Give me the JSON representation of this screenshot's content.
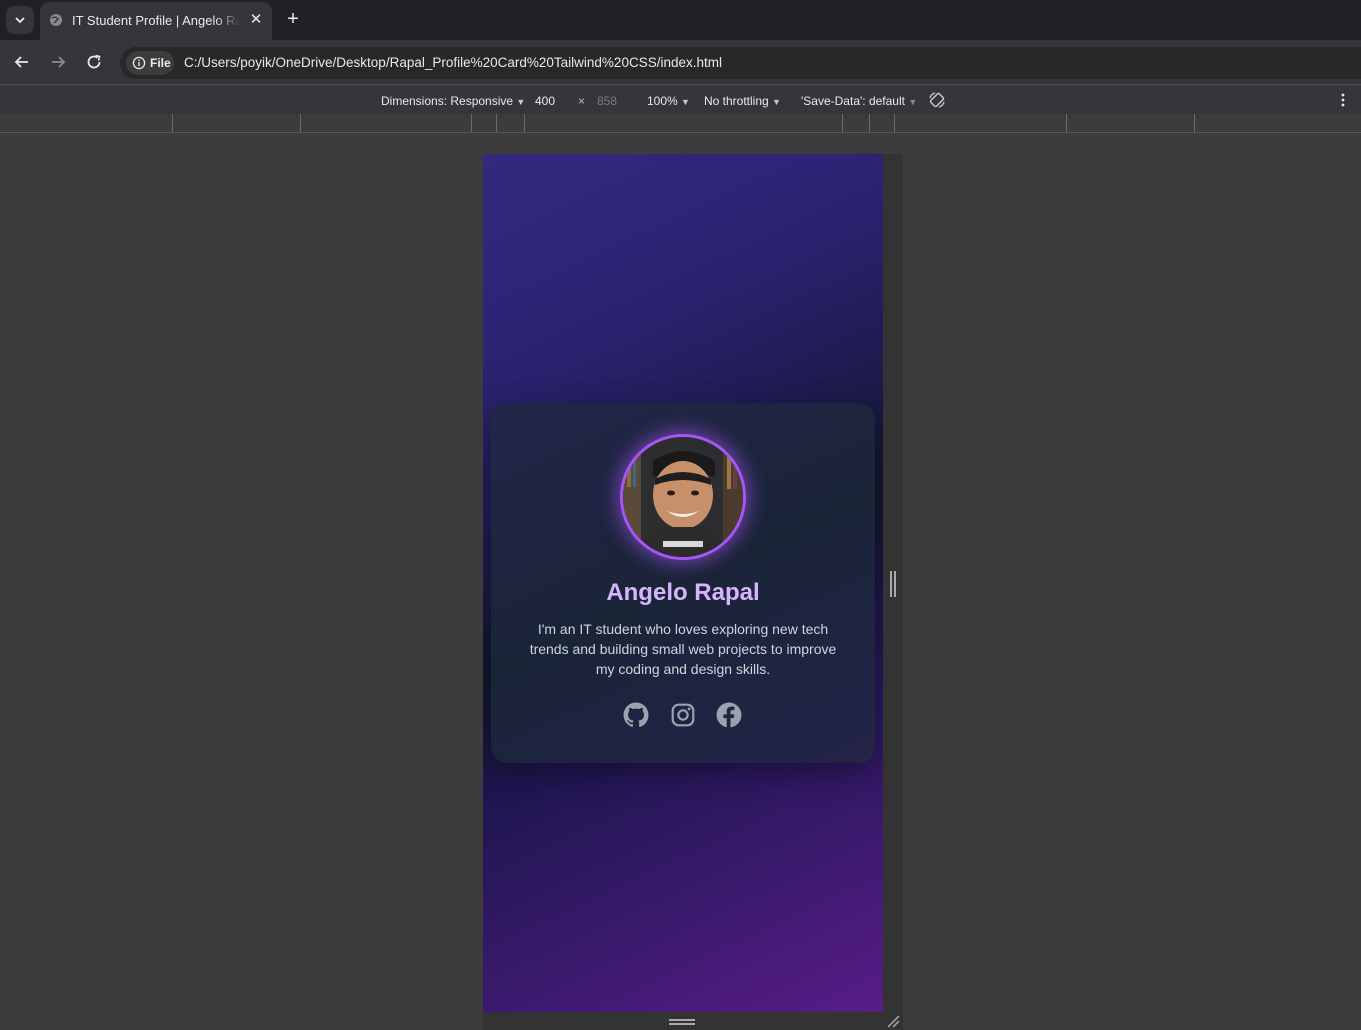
{
  "browser": {
    "tab": {
      "title": "IT Student Profile | Angelo Rapal"
    },
    "toolbar": {
      "chip_label": "File",
      "url": "C:/Users/poyik/OneDrive/Desktop/Rapal_Profile%20Card%20Tailwind%20CSS/index.html"
    }
  },
  "device_toolbar": {
    "dimensions_label": "Dimensions: Responsive",
    "width": "400",
    "separator": "×",
    "height": "858",
    "zoom": "100%",
    "throttling": "No throttling",
    "save_data": "'Save-Data': default"
  },
  "profile": {
    "name": "Angelo Rapal",
    "bio": "I'm an IT student who loves exploring new tech trends and building small web projects to improve my coding and design skills.",
    "socials": [
      "github-icon",
      "instagram-icon",
      "facebook-icon"
    ]
  },
  "colors": {
    "accent": "#a855f7",
    "name_color": "#d8b4fe",
    "icon_color": "#9ca3af"
  }
}
